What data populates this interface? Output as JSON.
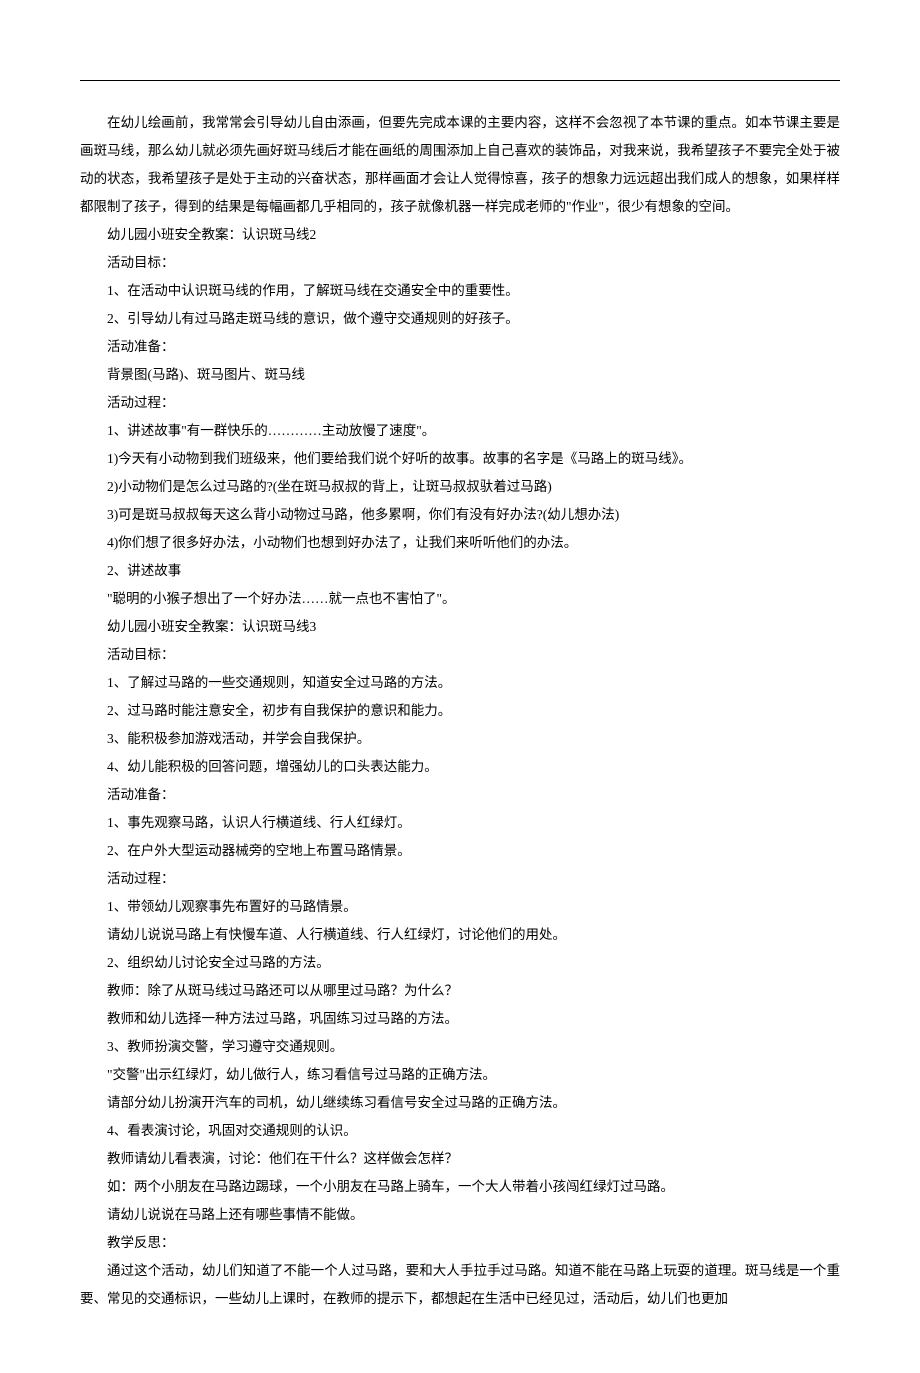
{
  "paragraphs": [
    "在幼儿绘画前，我常常会引导幼儿自由添画，但要先完成本课的主要内容，这样不会忽视了本节课的重点。如本节课主要是画斑马线，那么幼儿就必须先画好斑马线后才能在画纸的周围添加上自己喜欢的装饰品，对我来说，我希望孩子不要完全处于被动的状态，我希望孩子是处于主动的兴奋状态，那样画面才会让人觉得惊喜，孩子的想象力远远超出我们成人的想象，如果样样都限制了孩子，得到的结果是每幅画都几乎相同的，孩子就像机器一样完成老师的\"作业\"，很少有想象的空间。",
    "幼儿园小班安全教案：认识斑马线2",
    "活动目标：",
    "1、在活动中认识斑马线的作用，了解斑马线在交通安全中的重要性。",
    "2、引导幼儿有过马路走斑马线的意识，做个遵守交通规则的好孩子。",
    "活动准备：",
    "背景图(马路)、斑马图片、斑马线",
    "活动过程：",
    "1、讲述故事\"有一群快乐的…………主动放慢了速度\"。",
    "1)今天有小动物到我们班级来，他们要给我们说个好听的故事。故事的名字是《马路上的斑马线》。",
    "2)小动物们是怎么过马路的?(坐在斑马叔叔的背上，让斑马叔叔驮着过马路)",
    "3)可是斑马叔叔每天这么背小动物过马路，他多累啊，你们有没有好办法?(幼儿想办法)",
    "4)你们想了很多好办法，小动物们也想到好办法了，让我们来听听他们的办法。",
    "2、讲述故事",
    "\"聪明的小猴子想出了一个好办法……就一点也不害怕了\"。",
    "幼儿园小班安全教案：认识斑马线3",
    "活动目标：",
    "1、了解过马路的一些交通规则，知道安全过马路的方法。",
    "2、过马路时能注意安全，初步有自我保护的意识和能力。",
    "3、能积极参加游戏活动，并学会自我保护。",
    "4、幼儿能积极的回答问题，增强幼儿的口头表达能力。",
    "活动准备：",
    "1、事先观察马路，认识人行横道线、行人红绿灯。",
    "2、在户外大型运动器械旁的空地上布置马路情景。",
    "活动过程：",
    "1、带领幼儿观察事先布置好的马路情景。",
    "请幼儿说说马路上有快慢车道、人行横道线、行人红绿灯，讨论他们的用处。",
    "2、组织幼儿讨论安全过马路的方法。",
    "教师：除了从斑马线过马路还可以从哪里过马路？为什么？",
    "教师和幼儿选择一种方法过马路，巩固练习过马路的方法。",
    "3、教师扮演交警，学习遵守交通规则。",
    "\"交警\"出示红绿灯，幼儿做行人，练习看信号过马路的正确方法。",
    "请部分幼儿扮演开汽车的司机，幼儿继续练习看信号安全过马路的正确方法。",
    "4、看表演讨论，巩固对交通规则的认识。",
    "教师请幼儿看表演，讨论：他们在干什么？这样做会怎样？",
    "如：两个小朋友在马路边踢球，一个小朋友在马路上骑车，一个大人带着小孩闯红绿灯过马路。",
    "请幼儿说说在马路上还有哪些事情不能做。",
    "教学反思：",
    "通过这个活动，幼儿们知道了不能一个人过马路，要和大人手拉手过马路。知道不能在马路上玩耍的道理。斑马线是一个重要、常见的交通标识，一些幼儿上课时，在教师的提示下，都想起在生活中已经见过，活动后，幼儿们也更加"
  ]
}
